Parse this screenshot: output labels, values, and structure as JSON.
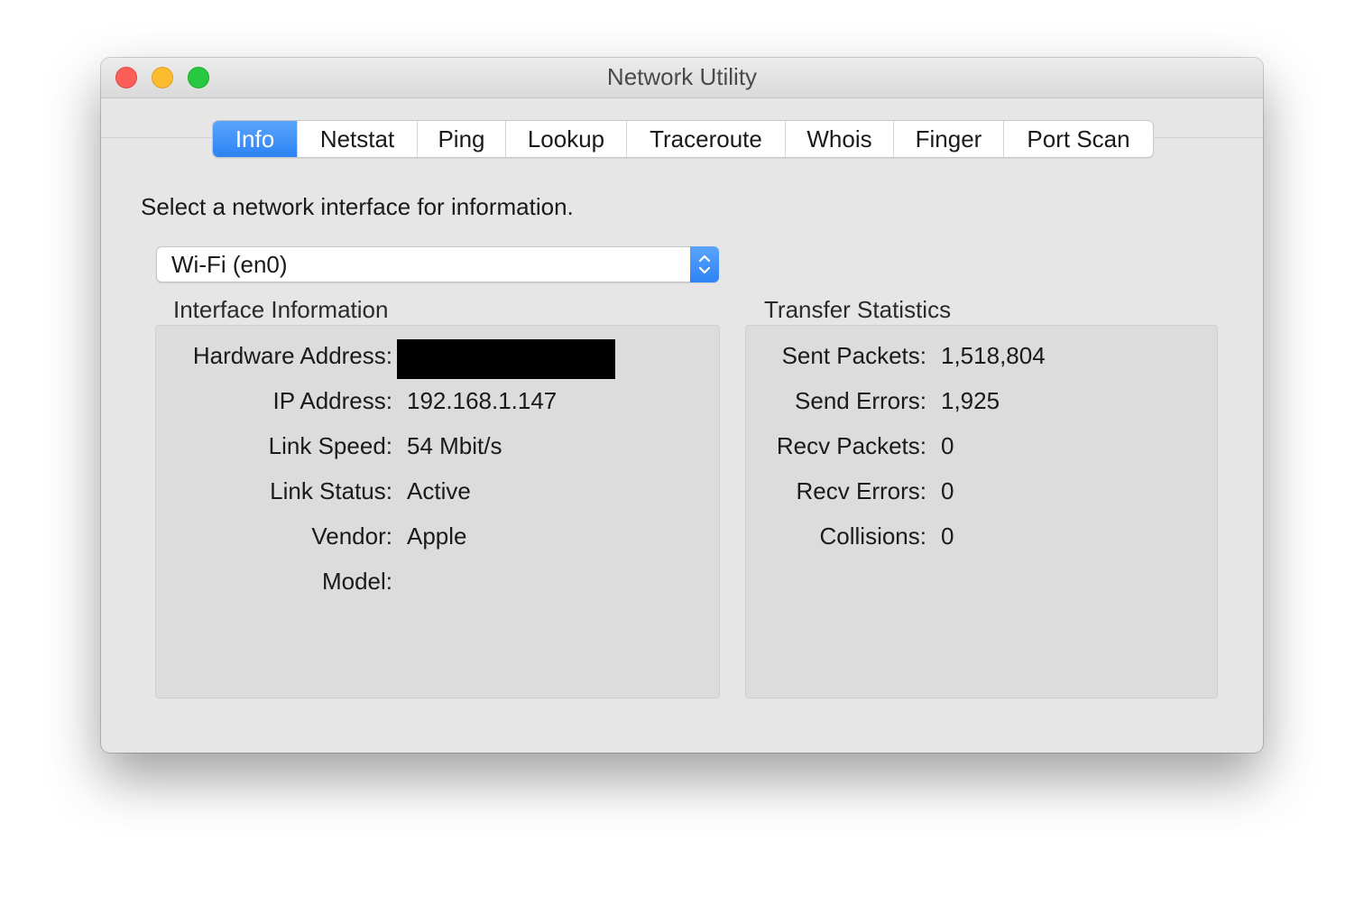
{
  "window": {
    "title": "Network Utility"
  },
  "tabs": [
    {
      "label": "Info",
      "active": true
    },
    {
      "label": "Netstat",
      "active": false
    },
    {
      "label": "Ping",
      "active": false
    },
    {
      "label": "Lookup",
      "active": false
    },
    {
      "label": "Traceroute",
      "active": false
    },
    {
      "label": "Whois",
      "active": false
    },
    {
      "label": "Finger",
      "active": false
    },
    {
      "label": "Port Scan",
      "active": false
    }
  ],
  "prompt": "Select a network interface for information.",
  "interface_select": {
    "value": "Wi-Fi (en0)",
    "icon": "chevron-updown-icon"
  },
  "interface_info": {
    "heading": "Interface Information",
    "rows": [
      {
        "label": "Hardware Address:",
        "value": ""
      },
      {
        "label": "IP Address:",
        "value": "192.168.1.147"
      },
      {
        "label": "Link Speed:",
        "value": "54 Mbit/s"
      },
      {
        "label": "Link Status:",
        "value": "Active"
      },
      {
        "label": "Vendor:",
        "value": "Apple"
      },
      {
        "label": "Model:",
        "value": ""
      }
    ]
  },
  "transfer_stats": {
    "heading": "Transfer Statistics",
    "rows": [
      {
        "label": "Sent Packets:",
        "value": "1,518,804"
      },
      {
        "label": "Send Errors:",
        "value": "1,925"
      },
      {
        "label": "Recv Packets:",
        "value": "0"
      },
      {
        "label": "Recv Errors:",
        "value": "0"
      },
      {
        "label": "Collisions:",
        "value": "0"
      }
    ]
  },
  "colors": {
    "accent": "#2d83f5",
    "close": "#fc5f57",
    "minimize": "#fdbc2e",
    "maximize": "#28c840"
  }
}
